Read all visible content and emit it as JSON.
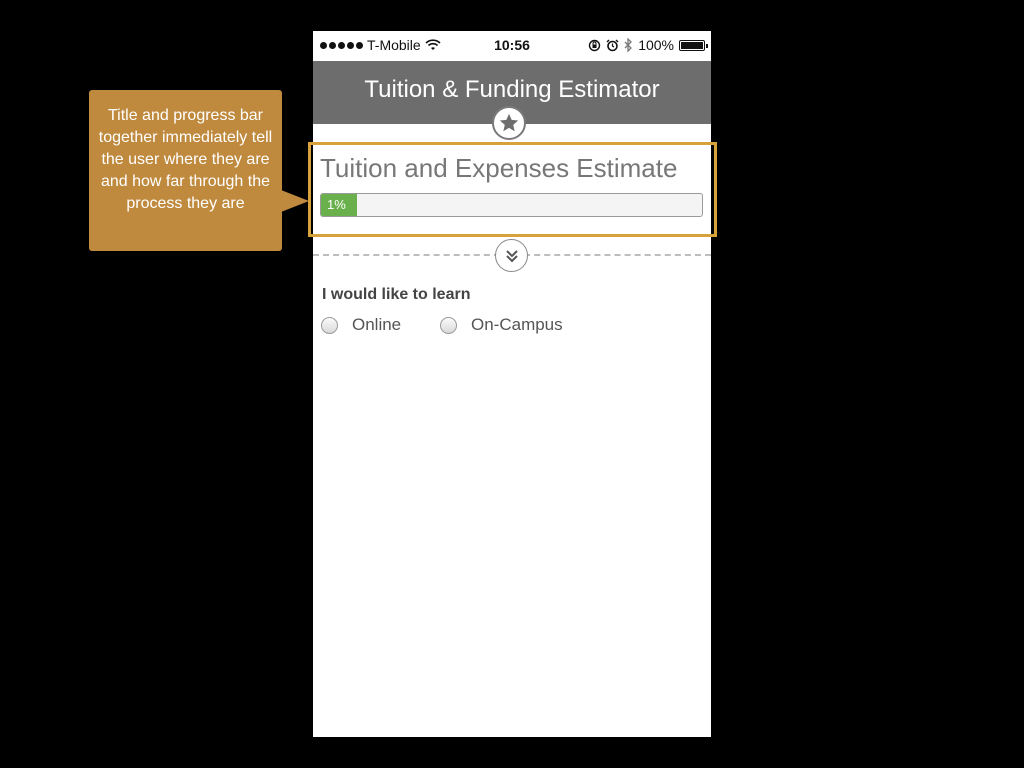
{
  "status_bar": {
    "carrier": "T-Mobile",
    "time": "10:56",
    "battery_percent": "100%",
    "battery_level": 1.0,
    "icons": [
      "signal-dots-icon",
      "wifi-icon",
      "rotation-lock-icon",
      "alarm-icon",
      "bluetooth-icon",
      "battery-icon"
    ]
  },
  "header": {
    "title": "Tuition & Funding Estimator",
    "badge_icon": "star-icon"
  },
  "progress": {
    "title": "Tuition and Expenses Estimate",
    "label": "1%",
    "value": 1
  },
  "divider": {
    "expand_icon": "double-chevron-down-icon"
  },
  "form": {
    "question": "I would like to learn",
    "options": [
      {
        "label": "Online",
        "selected": false
      },
      {
        "label": "On-Campus",
        "selected": false
      }
    ]
  },
  "annotation": {
    "text": "Title and progress bar together immediately tell the user where they are and how far through the process they are"
  },
  "colors": {
    "header_bg": "#6d6d6d",
    "progress_fill": "#6ab04c",
    "annotation_bg": "#bf8a3e",
    "highlight_border": "#d7a23a"
  }
}
